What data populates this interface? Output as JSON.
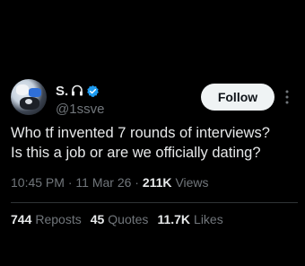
{
  "author": {
    "display_name": "S.",
    "handle": "@1ssve",
    "emoji_icon": "headphones-icon",
    "verified_icon": "verified-badge-icon",
    "verified_color": "#1d9bf0"
  },
  "follow_button": {
    "label": "Follow"
  },
  "tweet": {
    "text": "Who tf invented 7 rounds of interviews?\nIs this a job or are we officially dating?"
  },
  "meta": {
    "time": "10:45 PM",
    "separator": "·",
    "date": "11 Mar 26",
    "views_count": "211K",
    "views_label": "Views"
  },
  "stats": {
    "reposts_count": "744",
    "reposts_label": "Reposts",
    "quotes_count": "45",
    "quotes_label": "Quotes",
    "likes_count": "11.7K",
    "likes_label": "Likes"
  },
  "colors": {
    "background": "#000000",
    "text_primary": "#e7e9ea",
    "text_secondary": "#71767b",
    "button_bg": "#eff3f4",
    "divider": "#2f3336"
  }
}
